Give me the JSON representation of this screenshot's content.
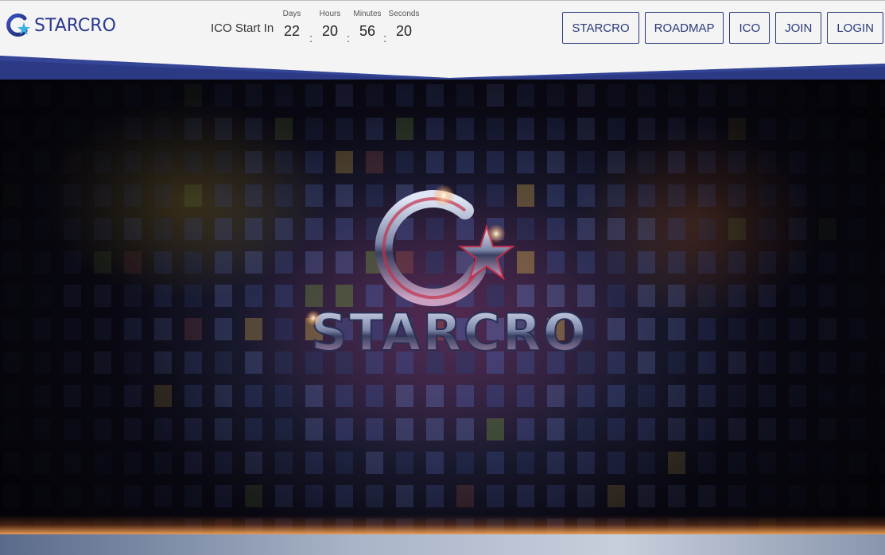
{
  "brand": {
    "name": "STARCRO",
    "color": "#2b3a8f"
  },
  "countdown": {
    "label": "ICO Start In",
    "units": [
      {
        "caption": "Days",
        "value": "22"
      },
      {
        "caption": "Hours",
        "value": "20"
      },
      {
        "caption": "Minutes",
        "value": "56"
      },
      {
        "caption": "Seconds",
        "value": "20"
      }
    ],
    "separator": ":"
  },
  "nav": {
    "items": [
      "STARCRO",
      "ROADMAP",
      "ICO",
      "JOIN",
      "LOGIN"
    ]
  },
  "hero": {
    "logo_text": "STARCRO"
  },
  "colors": {
    "accent": "#2b3a7a",
    "band": "#2c3a86"
  }
}
